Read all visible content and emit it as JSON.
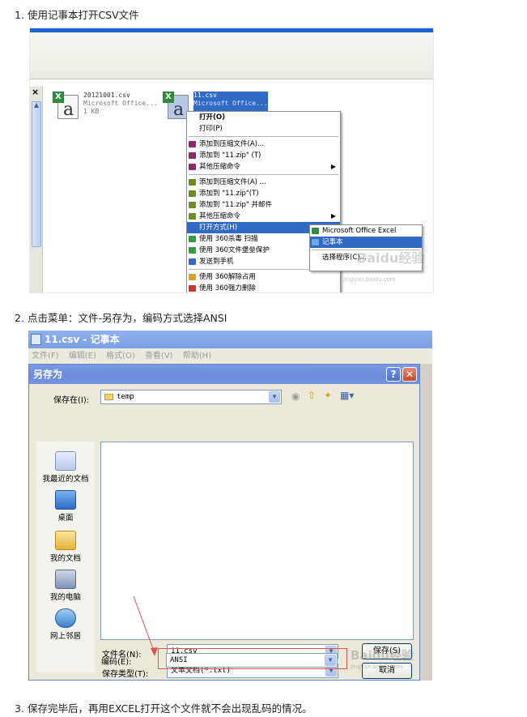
{
  "steps": [
    {
      "num": "1.",
      "text": "使用记事本打开CSV文件"
    },
    {
      "num": "2.",
      "text": "点击菜单：文件-另存为，编码方式选择ANSI"
    },
    {
      "num": "3.",
      "text": "保存完毕后，再用EXCEL打开这个文件就不会出现乱码的情况。"
    }
  ],
  "explorer": {
    "close_glyph": "×",
    "files": [
      {
        "name": "20121001.csv",
        "type": "Microsoft Office...",
        "size": "1 KB"
      },
      {
        "name": "11.csv",
        "type": "Microsoft Office..."
      }
    ],
    "context_menu": [
      {
        "label": "打开(O)",
        "bold": true,
        "icon": ""
      },
      {
        "label": "打印(P)",
        "icon": ""
      },
      {
        "sep": true
      },
      {
        "label": "添加到压缩文件(A)...",
        "icon": "winrar-icon"
      },
      {
        "label": "添加到 \"11.zip\" (T)",
        "icon": "winrar-icon"
      },
      {
        "label": "其他压缩命令",
        "icon": "winrar-icon",
        "submenu": true
      },
      {
        "sep": true
      },
      {
        "label": "添加到压缩文件(A) ...",
        "icon": "archive-icon"
      },
      {
        "label": "添加到 \"11.zip\"(T)",
        "icon": "archive-icon"
      },
      {
        "label": "添加到 \"11.zip\" 并邮件",
        "icon": "archive-icon"
      },
      {
        "label": "其他压缩命令",
        "icon": "archive-icon",
        "submenu": true
      },
      {
        "label": "打开方式(H)",
        "active": true,
        "submenu": true,
        "icon": ""
      },
      {
        "label": "使用 360杀毒 扫描",
        "icon": "shield-icon"
      },
      {
        "label": "使用 360文件堡垒保护",
        "icon": "shield-icon"
      },
      {
        "label": "发送到手机",
        "icon": "phone-icon"
      },
      {
        "sep": true
      },
      {
        "label": "使用 360解除占用",
        "icon": "unlock-icon"
      },
      {
        "label": "使用 360强力删除",
        "icon": "delete-icon"
      }
    ],
    "open_with": [
      {
        "label": "Microsoft Office Excel",
        "icon": "excel-icon"
      },
      {
        "label": "记事本",
        "icon": "notepad-icon",
        "active": true
      },
      {
        "label": "选择程序(C)...",
        "icon": ""
      }
    ],
    "watermark": "Baidu经验",
    "watermark_url": "jingyan.baidu.com"
  },
  "notepad": {
    "title": "11.csv - 记事本",
    "menu": [
      "文件(F)",
      "编辑(E)",
      "格式(O)",
      "查看(V)",
      "帮助(H)"
    ]
  },
  "save_dialog": {
    "title": "另存为",
    "help_glyph": "?",
    "close_glyph": "✕",
    "save_in_label": "保存在(I):",
    "save_in_value": "temp",
    "places": [
      "我最近的文档",
      "桌面",
      "我的文档",
      "我的电脑",
      "网上邻居"
    ],
    "filename_label": "文件名(N):",
    "filename_value": "11.csv",
    "filetype_label": "保存类型(T):",
    "filetype_value": "文本文档(*.txt)",
    "encoding_label": "编码(E):",
    "encoding_value": "ANSI",
    "save_button": "保存(S)",
    "cancel_button": "取消",
    "watermark": "Baidu经验",
    "watermark_url": "jingyan.baidu.com"
  }
}
